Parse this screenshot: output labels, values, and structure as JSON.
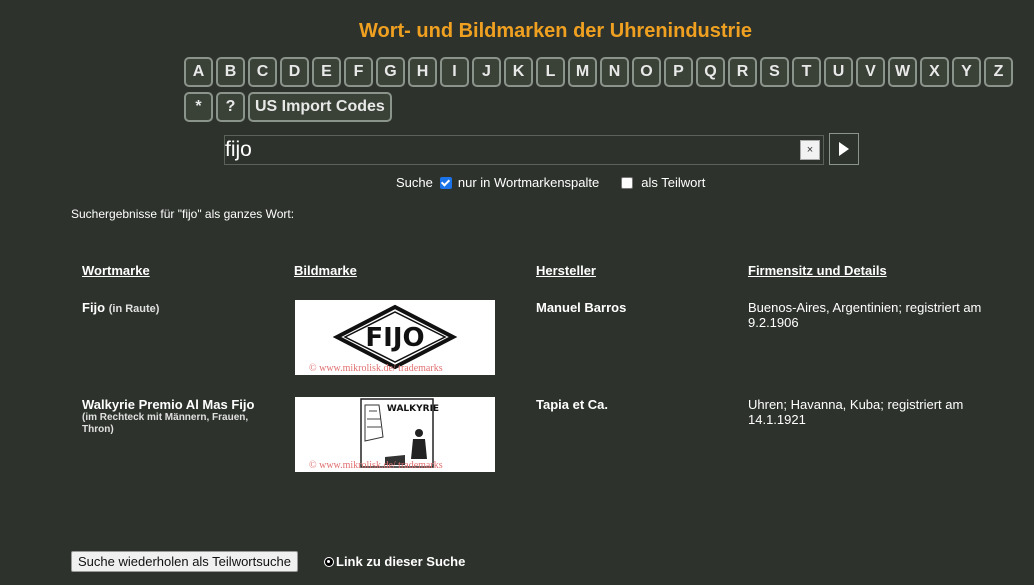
{
  "title": "Wort- und Bildmarken der Uhrenindustrie",
  "letters_row1": [
    "A",
    "B",
    "C",
    "D",
    "E",
    "F",
    "G",
    "H",
    "I",
    "J",
    "K",
    "L",
    "M",
    "N",
    "O",
    "P",
    "Q",
    "R",
    "S",
    "T",
    "U",
    "V",
    "W",
    "X",
    "Y",
    "Z"
  ],
  "letters_row2": [
    "*",
    "?"
  ],
  "us_import_label": "US Import Codes",
  "search": {
    "value": "fijo",
    "clear_label": "×"
  },
  "options": {
    "search_label": "Suche",
    "only_wordmark_label": "nur in Wortmarkenspalte",
    "only_wordmark_checked": true,
    "partial_label": "als Teilwort",
    "partial_checked": false
  },
  "results_label": "Suchergebnisse für \"fijo\" als ganzes Wort:",
  "columns": [
    "Wortmarke",
    "Bildmarke",
    "Hersteller",
    "Firmensitz und Details"
  ],
  "rows": [
    {
      "wordmark": "Fijo",
      "wordmark_note": "(in Raute)",
      "image_label": "FIJO",
      "watermark": "© www.mikrolisk.de/ trademarks",
      "maker": "Manuel Barros",
      "details": "Buenos-Aires, Argentinien; registriert am 9.2.1906"
    },
    {
      "wordmark": "Walkyrie Premio Al Mas Fijo",
      "wordmark_note": "(im Rechteck mit Männern, Frauen, Thron)",
      "image_label": "WALKYRIE",
      "watermark": "© www.mikrolisk.de/ trademarks",
      "maker": "Tapia et Ca.",
      "details": "Uhren; Havanna, Kuba; registriert am 14.1.1921"
    }
  ],
  "repeat_button_label": "Suche wiederholen als Teilwortsuche",
  "link_label": "Link zu dieser Suche"
}
